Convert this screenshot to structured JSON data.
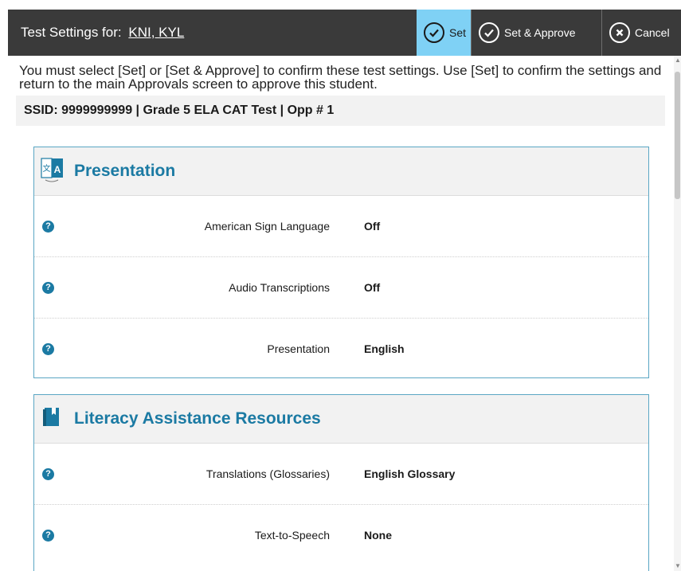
{
  "header": {
    "title": "Test Settings for:",
    "student": "KNI, KYL",
    "buttons": {
      "set": "Set",
      "set_approve": "Set & Approve",
      "cancel": "Cancel"
    }
  },
  "instructions": "You must select [Set] or [Set & Approve] to confirm these test settings. Use [Set] to confirm the settings and return to the main Approvals screen to approve this student.",
  "ssid_line": "SSID: 9999999999 | Grade 5 ELA CAT Test | Opp # 1",
  "sections": [
    {
      "title": "Presentation",
      "icon": "presentation-language-icon",
      "rows": [
        {
          "label": "American Sign Language",
          "value": "Off"
        },
        {
          "label": "Audio Transcriptions",
          "value": "Off"
        },
        {
          "label": "Presentation",
          "value": "English"
        }
      ]
    },
    {
      "title": "Literacy Assistance Resources",
      "icon": "book-icon",
      "rows": [
        {
          "label": "Translations (Glossaries)",
          "value": "English Glossary"
        },
        {
          "label": "Text-to-Speech",
          "value": "None"
        }
      ]
    }
  ],
  "colors": {
    "titlebar": "#3a3a3a",
    "set_button": "#7fd1f5",
    "accent": "#1b7aa3",
    "panel_border": "#5aa6c4"
  }
}
